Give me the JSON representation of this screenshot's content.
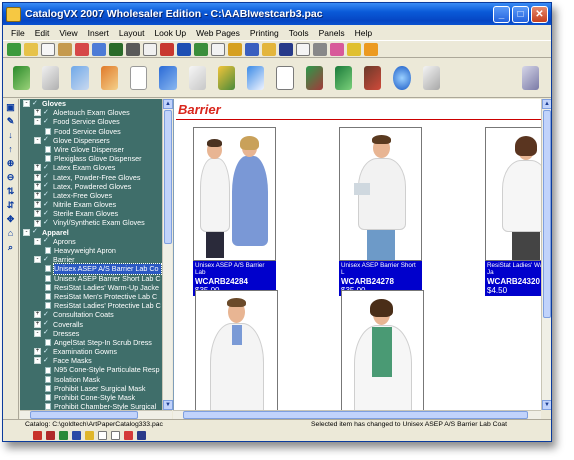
{
  "window": {
    "title": "CatalogVX 2007 Wholesaler Edition - C:\\AABIwestcarb3.pac",
    "minimize_label": "_",
    "maximize_label": "□",
    "close_label": "✕"
  },
  "menu": [
    "File",
    "Edit",
    "View",
    "Insert",
    "Layout",
    "Look Up",
    "Web Pages",
    "Printing",
    "Tools",
    "Panels",
    "Help"
  ],
  "tree": {
    "rows": [
      {
        "indent": 0,
        "pm": "-",
        "kind": "check",
        "label": "Gloves",
        "bold": true
      },
      {
        "indent": 1,
        "pm": "+",
        "kind": "check",
        "label": "Aloetouch Exam Gloves"
      },
      {
        "indent": 1,
        "pm": "-",
        "kind": "check",
        "label": "Food Service Gloves"
      },
      {
        "indent": 2,
        "pm": "",
        "kind": "doc",
        "label": "Food Service Gloves"
      },
      {
        "indent": 1,
        "pm": "-",
        "kind": "check",
        "label": "Glove Dispensers"
      },
      {
        "indent": 2,
        "pm": "",
        "kind": "doc",
        "label": "Wire Glove Dispenser"
      },
      {
        "indent": 2,
        "pm": "",
        "kind": "doc",
        "label": "Plexiglass Glove Dispenser"
      },
      {
        "indent": 1,
        "pm": "+",
        "kind": "check",
        "label": "Latex Exam Gloves"
      },
      {
        "indent": 1,
        "pm": "+",
        "kind": "check",
        "label": "Latex, Powder-Free Gloves"
      },
      {
        "indent": 1,
        "pm": "+",
        "kind": "check",
        "label": "Latex, Powdered Gloves"
      },
      {
        "indent": 1,
        "pm": "+",
        "kind": "check",
        "label": "Latex-Free Gloves"
      },
      {
        "indent": 1,
        "pm": "+",
        "kind": "check",
        "label": "Nitrile Exam Gloves"
      },
      {
        "indent": 1,
        "pm": "+",
        "kind": "check",
        "label": "Sterile Exam Gloves"
      },
      {
        "indent": 1,
        "pm": "+",
        "kind": "check",
        "label": "Vinyl/Synthetic Exam Gloves"
      },
      {
        "indent": 0,
        "pm": "-",
        "kind": "check",
        "label": "Apparel",
        "bold": true
      },
      {
        "indent": 1,
        "pm": "-",
        "kind": "check",
        "label": "Aprons"
      },
      {
        "indent": 2,
        "pm": "",
        "kind": "doc",
        "label": "Heavyweight Apron"
      },
      {
        "indent": 1,
        "pm": "-",
        "kind": "check",
        "label": "Barrier"
      },
      {
        "indent": 2,
        "pm": "",
        "kind": "doc",
        "label": "Unisex ASEP A/S Barrier Lab Co",
        "selected": true
      },
      {
        "indent": 2,
        "pm": "",
        "kind": "doc",
        "label": "Unisex ASEP Barrier Short Lab C"
      },
      {
        "indent": 2,
        "pm": "",
        "kind": "doc",
        "label": "ResiStat Ladies' Warm-Up Jacke"
      },
      {
        "indent": 2,
        "pm": "",
        "kind": "doc",
        "label": "ResiStat Men's Protective Lab C"
      },
      {
        "indent": 2,
        "pm": "",
        "kind": "doc",
        "label": "ResiStat Ladies' Protective Lab C"
      },
      {
        "indent": 1,
        "pm": "+",
        "kind": "check",
        "label": "Consultation Coats"
      },
      {
        "indent": 1,
        "pm": "+",
        "kind": "check",
        "label": "Coveralls"
      },
      {
        "indent": 1,
        "pm": "-",
        "kind": "check",
        "label": "Dresses"
      },
      {
        "indent": 2,
        "pm": "",
        "kind": "doc",
        "label": "AngelStat Step-In Scrub Dress"
      },
      {
        "indent": 1,
        "pm": "+",
        "kind": "check",
        "label": "Examination Gowns"
      },
      {
        "indent": 1,
        "pm": "-",
        "kind": "check",
        "label": "Face Masks"
      },
      {
        "indent": 2,
        "pm": "",
        "kind": "doc",
        "label": "N95 Cone-Style Particulate Resp"
      },
      {
        "indent": 2,
        "pm": "",
        "kind": "doc",
        "label": "Isolation Mask"
      },
      {
        "indent": 2,
        "pm": "",
        "kind": "doc",
        "label": "Prohibit Laser Surgical Mask"
      },
      {
        "indent": 2,
        "pm": "",
        "kind": "doc",
        "label": "Prohibit Cone-Style Mask"
      },
      {
        "indent": 2,
        "pm": "",
        "kind": "doc",
        "label": "Prohibit Chamber-Style Surgical"
      }
    ]
  },
  "content": {
    "category_title": "Barrier",
    "products": [
      {
        "name": "Unisex ASEP A/S Barrier Lab",
        "code": "WCARB24284",
        "price": "$35.00"
      },
      {
        "name": "Unisex ASEP Barrier Short L",
        "code": "WCARB24278",
        "price": "$35.00"
      },
      {
        "name": "ResiStat Ladies' Warm-Up Ja",
        "code": "WCARB24320",
        "price": "$4.50"
      },
      {
        "name": "",
        "code": "",
        "price": ""
      },
      {
        "name": "",
        "code": "",
        "price": ""
      }
    ]
  },
  "status": {
    "catalog": "Catalog: C:\\goldtech\\ArtPaperCatalog333.pac",
    "message": "Selected item has changed to Unisex ASEP A/S Barrier Lab Coat"
  },
  "icons": {
    "toolbar1": [
      "new-icon",
      "open-icon",
      "copy-icon",
      "paste-icon",
      "print-icon",
      "find-icon",
      "tree-icon",
      "grid-icon",
      "page-icon",
      "cut-icon",
      "save-icon",
      "db-icon",
      "export-icon",
      "pen-icon",
      "help-icon"
    ],
    "toolbar2": [
      "book-icon",
      "ruler-icon",
      "fill-icon",
      "brush-icon",
      "blank-page-icon",
      "upload-icon",
      "chart-icon",
      "paint-icon",
      "folder-icon",
      "clipboard-icon",
      "books-icon",
      "binder-icon",
      "chair-icon",
      "globe-icon",
      "printer-icon",
      "arrow-icon"
    ]
  }
}
